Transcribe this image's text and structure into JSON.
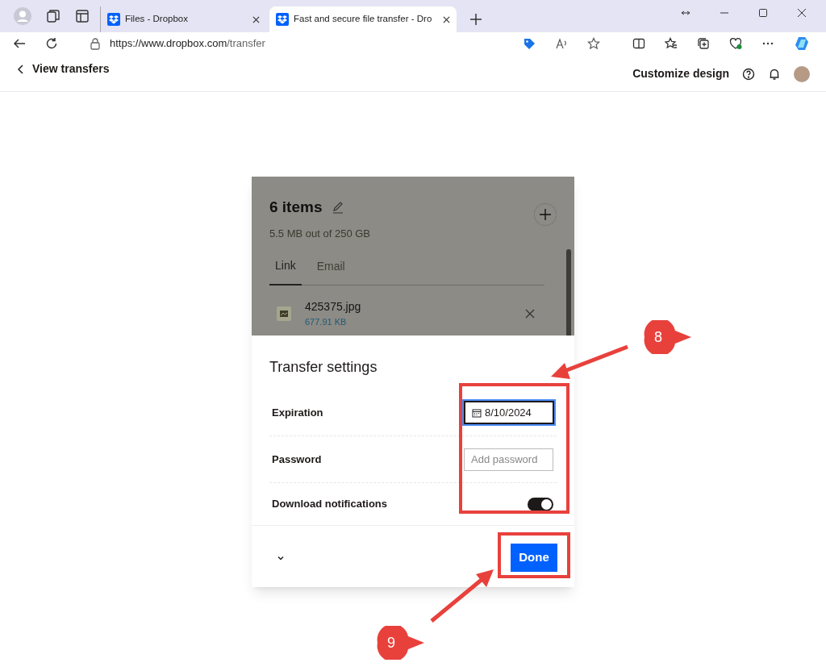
{
  "browser": {
    "tabs": [
      {
        "title": "Files - Dropbox",
        "selected": false
      },
      {
        "title": "Fast and secure file transfer - Dro",
        "selected": true
      }
    ],
    "url_host": "https://www.dropbox.com",
    "url_path": "/transfer"
  },
  "header": {
    "back_link": "View transfers",
    "customize": "Customize design"
  },
  "transfer": {
    "title": "6 items",
    "usage": "5.5 MB out of 250 GB",
    "tabs": [
      {
        "label": "Link",
        "selected": true
      },
      {
        "label": "Email",
        "selected": false
      }
    ],
    "files": [
      {
        "name": "425375.jpg",
        "size": "677.91 KB"
      }
    ]
  },
  "settings": {
    "title": "Transfer settings",
    "rows": [
      {
        "kind": "date",
        "label": "Expiration",
        "value": "8/10/2024"
      },
      {
        "kind": "text",
        "label": "Password",
        "placeholder": "Add password"
      },
      {
        "kind": "toggle",
        "label": "Download notifications",
        "on": true
      }
    ],
    "done": "Done"
  },
  "callouts": [
    "8",
    "9"
  ]
}
